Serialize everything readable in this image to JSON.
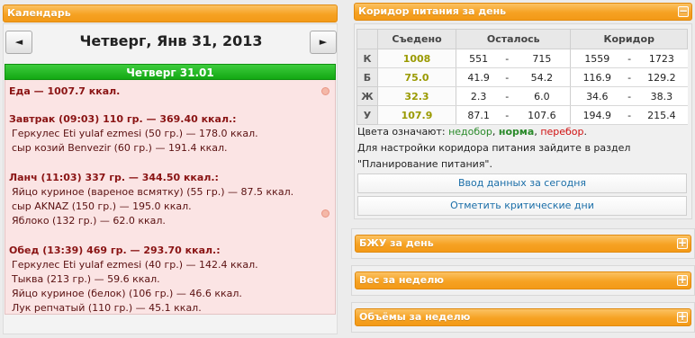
{
  "calendar": {
    "header_title": "Календарь",
    "prev_label": "◄",
    "next_label": "►",
    "date_title": "Четверг, Янв 31, 2013",
    "day_header": "Четверг 31.01",
    "lines": [
      {
        "text": "Еда — 1007.7 ккал.",
        "kind": "b"
      },
      {
        "text": "Завтрак (09:03) 110 гр. — 369.40 ккал.:",
        "kind": "b"
      },
      {
        "text": "Геркулес Eti yulaf ezmesi (50 гр.) — 178.0 ккал.",
        "kind": "item"
      },
      {
        "text": "сыр козий Benvezir (60 гр.) — 191.4 ккал.",
        "kind": "item"
      },
      {
        "text": "Ланч (11:03) 337 гр. — 344.50 ккал.:",
        "kind": "b"
      },
      {
        "text": "Яйцо куриное (вареное всмятку) (55 гр.) — 87.5 ккал.",
        "kind": "item"
      },
      {
        "text": "сыр AKNAZ (150 гр.) — 195.0 ккал.",
        "kind": "item"
      },
      {
        "text": "Яблоко (132 гр.) — 62.0 ккал.",
        "kind": "item"
      },
      {
        "text": "Обед (13:39) 469 гр. — 293.70 ккал.:",
        "kind": "b"
      },
      {
        "text": "Геркулес Eti yulaf ezmesi (40 гр.) — 142.4 ккал.",
        "kind": "item"
      },
      {
        "text": "Тыква (213 гр.) — 59.6 ккал.",
        "kind": "item"
      },
      {
        "text": "Яйцо куриное (белок) (106 гр.) — 46.6 ккал.",
        "kind": "item"
      },
      {
        "text": "Лук репчатый (110 гр.) — 45.1 ккал.",
        "kind": "item"
      }
    ]
  },
  "corridor": {
    "header_title": "Коридор питания за день",
    "toggle": "−",
    "columns": [
      "Съедено",
      "Осталось",
      "Коридор"
    ],
    "rows": [
      {
        "label": "К",
        "eaten": "1008",
        "left_min": "551",
        "left_max": "715",
        "corr_min": "1559",
        "corr_max": "1723"
      },
      {
        "label": "Б",
        "eaten": "75.0",
        "left_min": "41.9",
        "left_max": "54.2",
        "corr_min": "116.9",
        "corr_max": "129.2"
      },
      {
        "label": "Ж",
        "eaten": "32.3",
        "left_min": "2.3",
        "left_max": "6.0",
        "corr_min": "34.6",
        "corr_max": "38.3"
      },
      {
        "label": "У",
        "eaten": "107.9",
        "left_min": "87.1",
        "left_max": "107.6",
        "corr_min": "194.9",
        "corr_max": "215.4"
      }
    ],
    "dash": "-",
    "legend_prefix": "Цвета означают: ",
    "legend_under": "недобор",
    "legend_sep1": ", ",
    "legend_norm": "норма",
    "legend_sep2": ", ",
    "legend_over": "перебор",
    "legend_end": ".",
    "note1": "Для настройки коридора питания зайдите в раздел",
    "note2": "\"Планирование питания\".",
    "btn_enter": "Ввод данных за сегодня",
    "btn_critical": "Отметить критические дни"
  },
  "sections": [
    {
      "title": "БЖУ за день",
      "toggle": "+"
    },
    {
      "title": "Вес за неделю",
      "toggle": "+"
    },
    {
      "title": "Объёмы за неделю",
      "toggle": "+"
    }
  ]
}
